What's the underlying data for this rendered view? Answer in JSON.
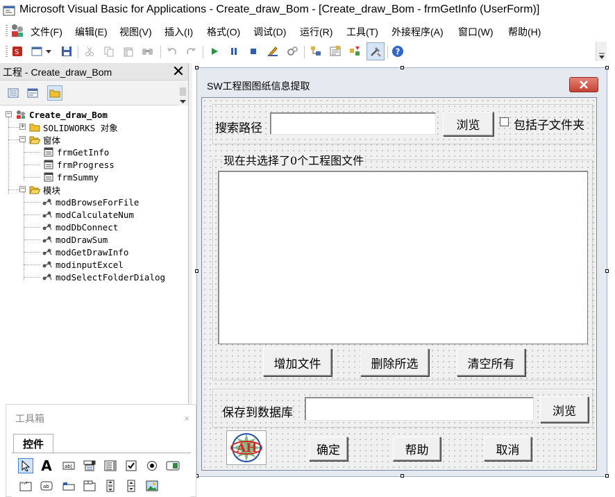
{
  "window": {
    "title": "Microsoft Visual Basic for Applications - Create_draw_Bom - [Create_draw_Bom - frmGetInfo (UserForm)]"
  },
  "menu": [
    "文件(F)",
    "编辑(E)",
    "视图(V)",
    "插入(I)",
    "格式(O)",
    "调试(D)",
    "运行(R)",
    "工具(T)",
    "外接程序(A)",
    "窗口(W)",
    "帮助(H)"
  ],
  "toolbar": {
    "icons": [
      "view-excel-icon",
      "insert-userform-icon",
      "save-icon",
      "cut-icon",
      "copy-icon",
      "paste-icon",
      "find-icon",
      "undo-icon",
      "redo-icon",
      "run-icon",
      "break-icon",
      "reset-icon",
      "design-mode-icon",
      "project-explorer-icon",
      "properties-icon",
      "object-browser-icon",
      "toolbox-icon",
      "help-icon"
    ]
  },
  "project_explorer": {
    "title": "工程 - Create_draw_Bom",
    "tree": [
      {
        "label": "Create_draw_Bom",
        "level": 0,
        "type": "project",
        "expanded": true
      },
      {
        "label": "SOLIDWORKS 对象",
        "level": 1,
        "type": "folder",
        "expanded": false
      },
      {
        "label": "窗体",
        "level": 1,
        "type": "folder",
        "expanded": true
      },
      {
        "label": "frmGetInfo",
        "level": 2,
        "type": "form"
      },
      {
        "label": "frmProgress",
        "level": 2,
        "type": "form"
      },
      {
        "label": "frmSummy",
        "level": 2,
        "type": "form"
      },
      {
        "label": "模块",
        "level": 1,
        "type": "folder",
        "expanded": true
      },
      {
        "label": "modBrowseForFile",
        "level": 2,
        "type": "module"
      },
      {
        "label": "modCalculateNum",
        "level": 2,
        "type": "module"
      },
      {
        "label": "modDbConnect",
        "level": 2,
        "type": "module"
      },
      {
        "label": "modDrawSum",
        "level": 2,
        "type": "module"
      },
      {
        "label": "modGetDrawInfo",
        "level": 2,
        "type": "module"
      },
      {
        "label": "modinputExcel",
        "level": 2,
        "type": "module"
      },
      {
        "label": "modSelectFolderDialog",
        "level": 2,
        "type": "module"
      }
    ]
  },
  "userform": {
    "caption": "SW工程图图纸信息提取",
    "search_label": "搜索路径",
    "search_value": "",
    "browse_label": "浏览",
    "include_subfolders_label": "包括子文件夹",
    "include_subfolders_checked": false,
    "frame_caption": "现在共选择了0个工程图文件",
    "add_files_label": "增加文件",
    "delete_selected_label": "删除所选",
    "clear_all_label": "清空所有",
    "save_db_label": "保存到数据库",
    "save_db_value": "",
    "browse2_label": "浏览",
    "logo_text": "AH",
    "ok_label": "确定",
    "help_label": "帮助",
    "cancel_label": "取消"
  },
  "toolbox": {
    "title": "工具箱",
    "close": "×",
    "tab": "控件",
    "controls_row1": [
      "pointer-icon",
      "label-icon",
      "textbox-icon",
      "combobox-icon",
      "listbox-icon",
      "checkbox-icon",
      "optionbutton-icon",
      "togglebutton-icon"
    ],
    "controls_row2": [
      "frame-icon",
      "commandbutton-icon",
      "tabstrip-icon",
      "multipage-icon",
      "scrollbar-icon",
      "spinbutton-icon",
      "image-icon"
    ],
    "label_glyph": "A"
  },
  "colors": {
    "form_title_bg": "#e5eaf0",
    "close_button": "#c44332",
    "selection": "#cfe3fb",
    "logo_red": "#d9251c",
    "logo_blue": "#1f4fa8",
    "logo_green": "#2e8b3a"
  }
}
